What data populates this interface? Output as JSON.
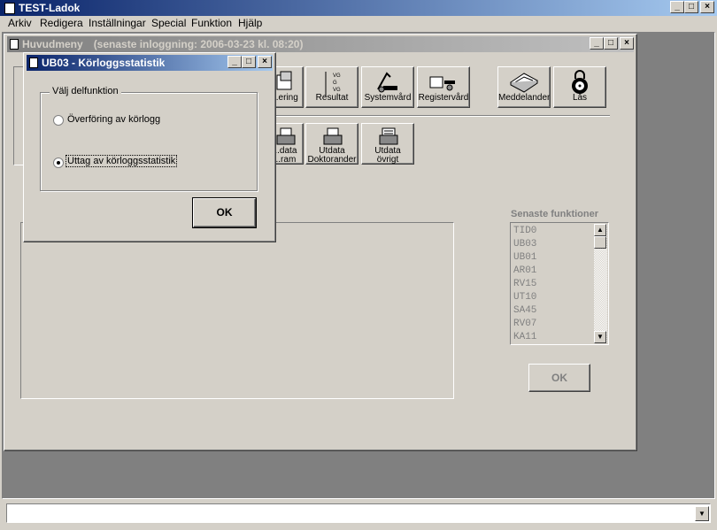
{
  "app": {
    "title": "TEST-Ladok"
  },
  "menubar": [
    "Arkiv",
    "Redigera",
    "Inställningar",
    "Special",
    "Funktion",
    "Hjälp"
  ],
  "main_window": {
    "title": "Huvudmeny",
    "last_login": "(senaste inloggning:  2006-03-23 kl. 08:20)"
  },
  "toolbar_row1": [
    {
      "label": "...ering",
      "icon": "registration-icon"
    },
    {
      "label": "Resultat",
      "icon": "result-icon"
    },
    {
      "label": "Systemvård",
      "icon": "system-care-icon"
    },
    {
      "label": "Registervård",
      "icon": "register-care-icon"
    },
    {
      "label": "Meddelanden",
      "icon": "messages-icon"
    },
    {
      "label": "Lås",
      "icon": "lock-icon"
    }
  ],
  "toolbar_row2": [
    {
      "line1": "...data",
      "line2": "...ram",
      "icon": "output-program-icon"
    },
    {
      "line1": "Utdata",
      "line2": "Doktorander",
      "icon": "output-doctoral-icon"
    },
    {
      "line1": "Utdata",
      "line2": "övrigt",
      "icon": "output-other-icon"
    }
  ],
  "recent": {
    "title": "Senaste funktioner",
    "items": [
      "TID0",
      "UB03",
      "UB01",
      "AR01",
      "RV15",
      "UT10",
      "SA45",
      "RV07",
      "KA11"
    ],
    "ok_label": "OK"
  },
  "dialog": {
    "title": "UB03 - Körloggsstatistik",
    "group_label": "Välj delfunktion",
    "option1": "Överföring av körlogg",
    "option2": "Uttag av körloggsstatistik",
    "selected": 2,
    "ok_label": "OK"
  },
  "command": {
    "value": ""
  },
  "colors": {
    "titlebar_active": "#0a246a",
    "titlebar_inactive": "#808080",
    "desktop": "#808080"
  }
}
